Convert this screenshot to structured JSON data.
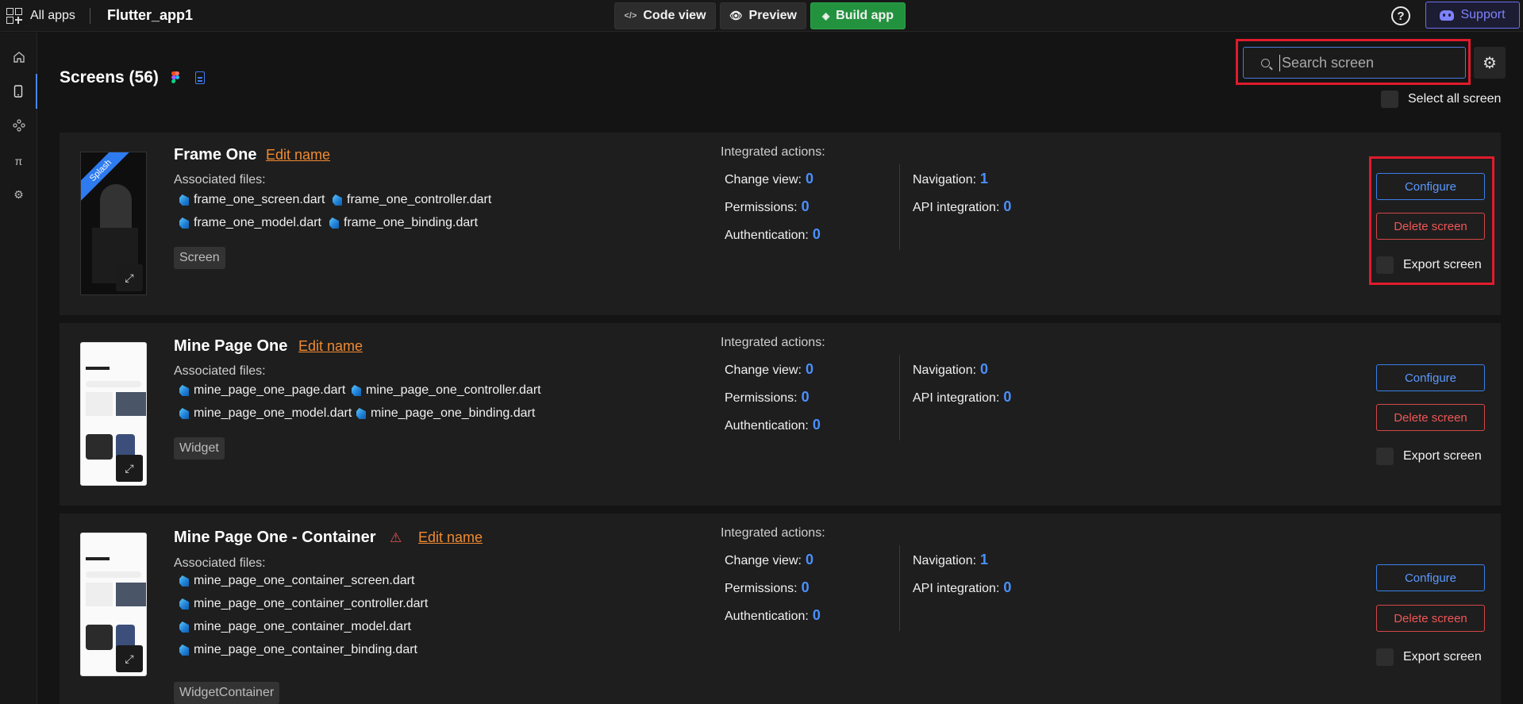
{
  "topbar": {
    "all_apps": "All apps",
    "app_name": "Flutter_app1",
    "code_view": "Code view",
    "preview": "Preview",
    "build_app": "Build app",
    "help": "?",
    "support": "Support"
  },
  "header": {
    "title": "Screens (56)",
    "search_placeholder": "Search screen",
    "select_all": "Select all screen"
  },
  "colors": {
    "accent": "#3a7fe8",
    "danger": "#f05656",
    "build": "#23923e",
    "edit": "#f08a32",
    "support": "#7d82ff"
  },
  "screens": [
    {
      "title": "Frame One",
      "edit": "Edit name",
      "ribbon": "Splash",
      "assoc_label": "Associated files:",
      "files": [
        "frame_one_screen.dart",
        "frame_one_controller.dart",
        "frame_one_model.dart",
        "frame_one_binding.dart"
      ],
      "tag": "Screen",
      "ia_label": "Integrated actions:",
      "change_view_label": "Change view:",
      "change_view": "0",
      "permissions_label": "Permissions:",
      "permissions": "0",
      "authentication_label": "Authentication:",
      "authentication": "0",
      "navigation_label": "Navigation:",
      "navigation": "1",
      "api_label": "API integration:",
      "api": "0",
      "configure": "Configure",
      "delete": "Delete screen",
      "export": "Export screen"
    },
    {
      "title": "Mine Page One",
      "edit": "Edit name",
      "assoc_label": "Associated files:",
      "files": [
        "mine_page_one_page.dart",
        "mine_page_one_controller.dart",
        "mine_page_one_model.dart",
        "mine_page_one_binding.dart"
      ],
      "tag": "Widget",
      "ia_label": "Integrated actions:",
      "change_view_label": "Change view:",
      "change_view": "0",
      "permissions_label": "Permissions:",
      "permissions": "0",
      "authentication_label": "Authentication:",
      "authentication": "0",
      "navigation_label": "Navigation:",
      "navigation": "0",
      "api_label": "API integration:",
      "api": "0",
      "configure": "Configure",
      "delete": "Delete screen",
      "export": "Export screen"
    },
    {
      "title": "Mine Page One - Container",
      "edit": "Edit name",
      "assoc_label": "Associated files:",
      "files": [
        "mine_page_one_container_screen.dart",
        "mine_page_one_container_controller.dart",
        "mine_page_one_container_model.dart",
        "mine_page_one_container_binding.dart"
      ],
      "tag": "WidgetContainer",
      "ia_label": "Integrated actions:",
      "change_view_label": "Change view:",
      "change_view": "0",
      "permissions_label": "Permissions:",
      "permissions": "0",
      "authentication_label": "Authentication:",
      "authentication": "0",
      "navigation_label": "Navigation:",
      "navigation": "1",
      "api_label": "API integration:",
      "api": "0",
      "configure": "Configure",
      "delete": "Delete screen",
      "export": "Export screen"
    }
  ]
}
